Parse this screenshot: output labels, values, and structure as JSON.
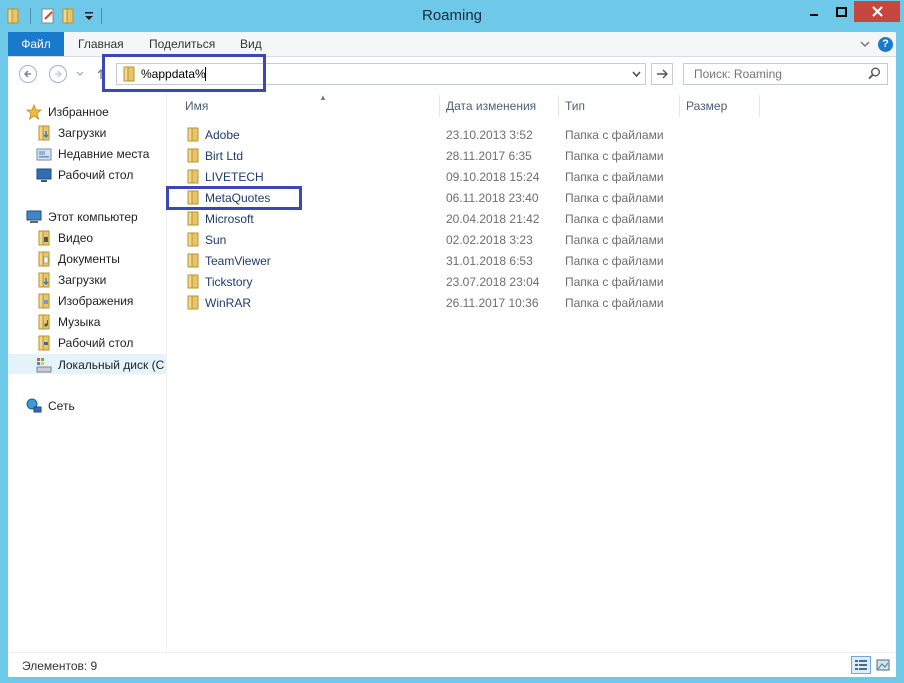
{
  "window": {
    "title": "Roaming",
    "accent": "#6ec8e8",
    "close_color": "#c7463f"
  },
  "ribbon": {
    "tabs": [
      "Файл",
      "Главная",
      "Поделиться",
      "Вид"
    ]
  },
  "address": {
    "value": "%appdata%",
    "search_placeholder": "Поиск: Roaming"
  },
  "sidebar": {
    "favorites": {
      "label": "Избранное",
      "icon": "star-icon",
      "items": [
        {
          "label": "Загрузки",
          "icon": "downloads-folder-icon"
        },
        {
          "label": "Недавние места",
          "icon": "recent-places-icon"
        },
        {
          "label": "Рабочий стол",
          "icon": "desktop-icon"
        }
      ]
    },
    "computer": {
      "label": "Этот компьютер",
      "icon": "computer-icon",
      "items": [
        {
          "label": "Видео",
          "icon": "videos-folder-icon"
        },
        {
          "label": "Документы",
          "icon": "documents-folder-icon"
        },
        {
          "label": "Загрузки",
          "icon": "downloads-folder-icon"
        },
        {
          "label": "Изображения",
          "icon": "pictures-folder-icon"
        },
        {
          "label": "Музыка",
          "icon": "music-folder-icon"
        },
        {
          "label": "Рабочий стол",
          "icon": "desktop-folder-icon"
        },
        {
          "label": "Локальный диск (C",
          "icon": "local-disk-icon"
        }
      ]
    },
    "network": {
      "label": "Сеть",
      "icon": "network-icon"
    }
  },
  "columns": [
    "Имя",
    "Дата изменения",
    "Тип",
    "Размер"
  ],
  "files": [
    {
      "name": "Adobe",
      "date": "23.10.2013 3:52",
      "type": "Папка с файлами"
    },
    {
      "name": "Birt Ltd",
      "date": "28.11.2017 6:35",
      "type": "Папка с файлами"
    },
    {
      "name": "LIVETECH",
      "date": "09.10.2018 15:24",
      "type": "Папка с файлами"
    },
    {
      "name": "MetaQuotes",
      "date": "06.11.2018 23:40",
      "type": "Папка с файлами"
    },
    {
      "name": "Microsoft",
      "date": "20.04.2018 21:42",
      "type": "Папка с файлами"
    },
    {
      "name": "Sun",
      "date": "02.02.2018 3:23",
      "type": "Папка с файлами"
    },
    {
      "name": "TeamViewer",
      "date": "31.01.2018 6:53",
      "type": "Папка с файлами"
    },
    {
      "name": "Tickstory",
      "date": "23.07.2018 23:04",
      "type": "Папка с файлами"
    },
    {
      "name": "WinRAR",
      "date": "26.11.2017 10:36",
      "type": "Папка с файлами"
    }
  ],
  "status": {
    "text": "Элементов: 9"
  },
  "highlight_color": "#3b47b4"
}
